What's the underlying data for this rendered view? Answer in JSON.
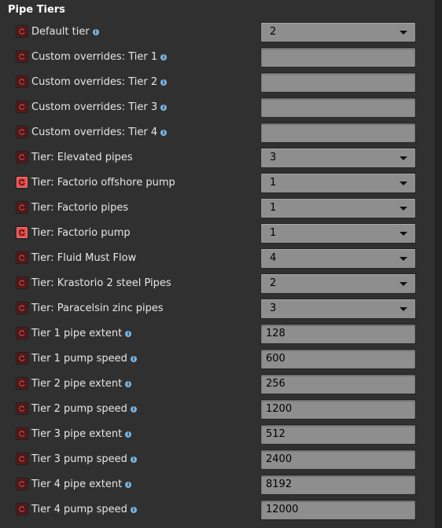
{
  "section": {
    "title": "Pipe Tiers"
  },
  "rows": [
    {
      "label": "Default tier",
      "info": true,
      "type": "dropdown",
      "value": "2",
      "reset_active": false
    },
    {
      "label": "Custom overrides: Tier 1",
      "info": true,
      "type": "text",
      "value": "",
      "reset_active": false
    },
    {
      "label": "Custom overrides: Tier 2",
      "info": true,
      "type": "text",
      "value": "",
      "reset_active": false
    },
    {
      "label": "Custom overrides: Tier 3",
      "info": true,
      "type": "text",
      "value": "",
      "reset_active": false
    },
    {
      "label": "Custom overrides: Tier 4",
      "info": true,
      "type": "text",
      "value": "",
      "reset_active": false
    },
    {
      "label": "Tier: Elevated pipes",
      "info": false,
      "type": "dropdown",
      "value": "3",
      "reset_active": false
    },
    {
      "label": "Tier: Factorio offshore pump",
      "info": false,
      "type": "dropdown",
      "value": "1",
      "reset_active": true
    },
    {
      "label": "Tier: Factorio pipes",
      "info": false,
      "type": "dropdown",
      "value": "1",
      "reset_active": false
    },
    {
      "label": "Tier: Factorio pump",
      "info": false,
      "type": "dropdown",
      "value": "1",
      "reset_active": true
    },
    {
      "label": "Tier: Fluid Must Flow",
      "info": false,
      "type": "dropdown",
      "value": "4",
      "reset_active": false
    },
    {
      "label": "Tier: Krastorio 2 steel Pipes",
      "info": false,
      "type": "dropdown",
      "value": "2",
      "reset_active": false
    },
    {
      "label": "Tier: Paracelsin zinc pipes",
      "info": false,
      "type": "dropdown",
      "value": "3",
      "reset_active": false
    },
    {
      "label": "Tier 1 pipe extent",
      "info": true,
      "type": "text",
      "value": "128",
      "reset_active": false
    },
    {
      "label": "Tier 1 pump speed",
      "info": true,
      "type": "text",
      "value": "600",
      "reset_active": false
    },
    {
      "label": "Tier 2 pipe extent",
      "info": true,
      "type": "text",
      "value": "256",
      "reset_active": false
    },
    {
      "label": "Tier 2 pump speed",
      "info": true,
      "type": "text",
      "value": "1200",
      "reset_active": false
    },
    {
      "label": "Tier 3 pipe extent",
      "info": true,
      "type": "text",
      "value": "512",
      "reset_active": false
    },
    {
      "label": "Tier 3 pump speed",
      "info": true,
      "type": "text",
      "value": "2400",
      "reset_active": false
    },
    {
      "label": "Tier 4 pipe extent",
      "info": true,
      "type": "text",
      "value": "8192",
      "reset_active": false
    },
    {
      "label": "Tier 4 pump speed",
      "info": true,
      "type": "text",
      "value": "12000",
      "reset_active": false
    }
  ],
  "icons": {
    "reset": "reset-icon",
    "info": "info-icon",
    "dropdown": "chevron-down-icon"
  },
  "colors": {
    "reset_inactive": "#4a1717",
    "reset_active": "#e84a4a",
    "info": "#7ab4e0",
    "field": "#8e8e8e"
  }
}
